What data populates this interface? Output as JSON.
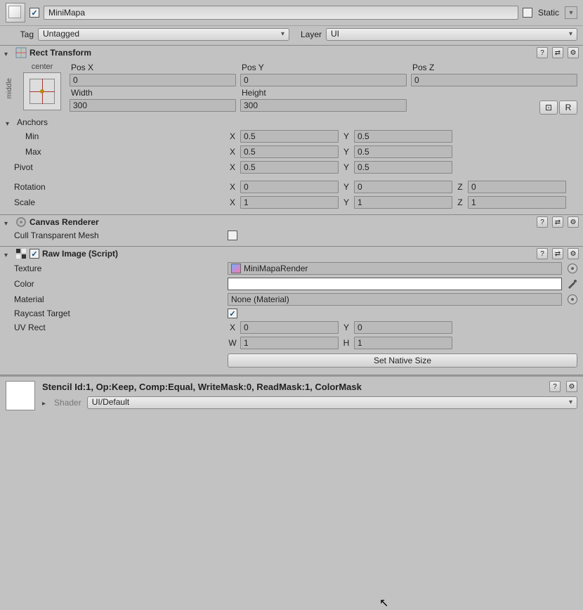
{
  "header": {
    "active": true,
    "name": "MiniMapa",
    "static_label": "Static",
    "static_checked": false
  },
  "tag": {
    "label": "Tag",
    "value": "Untagged"
  },
  "layer": {
    "label": "Layer",
    "value": "UI"
  },
  "rect_transform": {
    "title": "Rect Transform",
    "anchor_preview": {
      "htext": "center",
      "vtext": "middle"
    },
    "pos_x": {
      "label": "Pos X",
      "value": "0"
    },
    "pos_y": {
      "label": "Pos Y",
      "value": "0"
    },
    "pos_z": {
      "label": "Pos Z",
      "value": "0"
    },
    "width": {
      "label": "Width",
      "value": "300"
    },
    "height": {
      "label": "Height",
      "value": "300"
    },
    "blueprint_btn": "⊡",
    "raw_btn": "R",
    "anchors": {
      "label": "Anchors",
      "min": {
        "label": "Min",
        "x": "0.5",
        "y": "0.5"
      },
      "max": {
        "label": "Max",
        "x": "0.5",
        "y": "0.5"
      }
    },
    "pivot": {
      "label": "Pivot",
      "x": "0.5",
      "y": "0.5"
    },
    "rotation": {
      "label": "Rotation",
      "x": "0",
      "y": "0",
      "z": "0"
    },
    "scale": {
      "label": "Scale",
      "x": "1",
      "y": "1",
      "z": "1"
    }
  },
  "canvas_renderer": {
    "title": "Canvas Renderer",
    "cull": {
      "label": "Cull Transparent Mesh",
      "checked": false
    }
  },
  "raw_image": {
    "title": "Raw Image (Script)",
    "enabled": true,
    "texture": {
      "label": "Texture",
      "value": "MiniMapaRender"
    },
    "color": {
      "label": "Color",
      "value": "#FFFFFF"
    },
    "material": {
      "label": "Material",
      "value": "None (Material)"
    },
    "raycast": {
      "label": "Raycast Target",
      "checked": true
    },
    "uvrect": {
      "label": "UV Rect",
      "x": "0",
      "y": "0",
      "w": "1",
      "h": "1"
    },
    "set_native": "Set Native Size"
  },
  "material": {
    "title": "Stencil Id:1, Op:Keep, Comp:Equal, WriteMask:0, ReadMask:1, ColorMask",
    "shader_label": "Shader",
    "shader_value": "UI/Default"
  },
  "axis": {
    "x": "X",
    "y": "Y",
    "z": "Z",
    "w": "W",
    "h": "H"
  }
}
